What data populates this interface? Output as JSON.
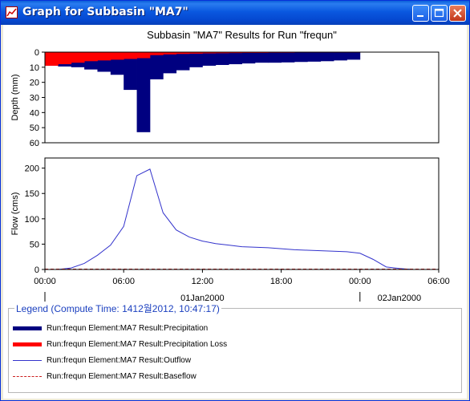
{
  "window": {
    "title": "Graph for Subbasin \"MA7\""
  },
  "colors": {
    "titlebar": "#0a58e0",
    "precip": "#000080",
    "loss": "#ff0000",
    "outflow": "#3333cc",
    "baseflow": "#cc2020"
  },
  "chart_data": [
    {
      "type": "bar",
      "title": "Subbasin \"MA7\" Results for Run \"frequn\"",
      "ylabel": "Depth (mm)",
      "ylim": [
        0,
        60
      ],
      "y_inverted": true,
      "yticks": [
        "0",
        "10",
        "20",
        "30",
        "40",
        "50",
        "60"
      ],
      "x_hours": [
        0,
        1,
        2,
        3,
        4,
        5,
        6,
        7,
        8,
        9,
        10,
        11,
        12,
        13,
        14,
        15,
        16,
        17,
        18,
        19,
        20,
        21,
        22,
        23
      ],
      "series": [
        {
          "name": "Run:frequn Element:MA7 Result:Precipitation",
          "values": [
            9,
            9.5,
            10,
            11.5,
            13,
            15,
            25,
            53,
            18,
            14,
            12,
            10,
            9,
            8.5,
            8,
            7.5,
            7,
            7,
            6.8,
            6.5,
            6.3,
            6,
            5.5,
            5
          ]
        },
        {
          "name": "Run:frequn Element:MA7 Result:Precipitation Loss",
          "values": [
            9,
            8,
            7,
            6,
            5.5,
            5,
            4.5,
            4,
            2,
            1.5,
            1.2,
            1,
            0.8,
            0.7,
            0.6,
            0.5,
            0.5,
            0.4,
            0.4,
            0.3,
            0.3,
            0.3,
            0.3,
            0.3
          ]
        }
      ]
    },
    {
      "type": "line",
      "ylabel": "Flow (cms)",
      "ylim": [
        0,
        220
      ],
      "yticks": [
        "0",
        "50",
        "100",
        "150",
        "200"
      ],
      "xticks": [
        "00:00",
        "06:00",
        "12:00",
        "18:00",
        "00:00",
        "06:00"
      ],
      "date_labels": [
        "01Jan2000",
        "02Jan2000"
      ],
      "series": [
        {
          "name": "Run:frequn Element:MA7 Result:Outflow",
          "x": [
            0,
            1,
            2,
            3,
            4,
            5,
            6,
            7,
            8,
            9,
            10,
            11,
            12,
            13,
            14,
            15,
            16,
            17,
            18,
            19,
            20,
            21,
            22,
            23,
            24,
            25,
            26,
            27,
            28,
            29,
            30
          ],
          "y": [
            0,
            0,
            3,
            12,
            28,
            48,
            85,
            185,
            198,
            112,
            78,
            64,
            56,
            51,
            48,
            45,
            44,
            43,
            41,
            39,
            38,
            37,
            36,
            35,
            32,
            20,
            5,
            2,
            0,
            0,
            0
          ]
        },
        {
          "name": "Run:frequn Element:MA7 Result:Baseflow",
          "x": [
            0,
            30
          ],
          "y": [
            0,
            0
          ]
        }
      ]
    }
  ],
  "legend": {
    "title": "Legend (Compute Time: 1412월2012, 10:47:17)",
    "items": [
      {
        "label": "Run:frequn Element:MA7 Result:Precipitation",
        "style": "thick",
        "color": "#000080"
      },
      {
        "label": "Run:frequn Element:MA7 Result:Precipitation Loss",
        "style": "thick",
        "color": "#ff0000"
      },
      {
        "label": "Run:frequn Element:MA7 Result:Outflow",
        "style": "thin",
        "color": "#3333cc"
      },
      {
        "label": "Run:frequn Element:MA7 Result:Baseflow",
        "style": "dashed",
        "color": "#cc2020"
      }
    ]
  }
}
